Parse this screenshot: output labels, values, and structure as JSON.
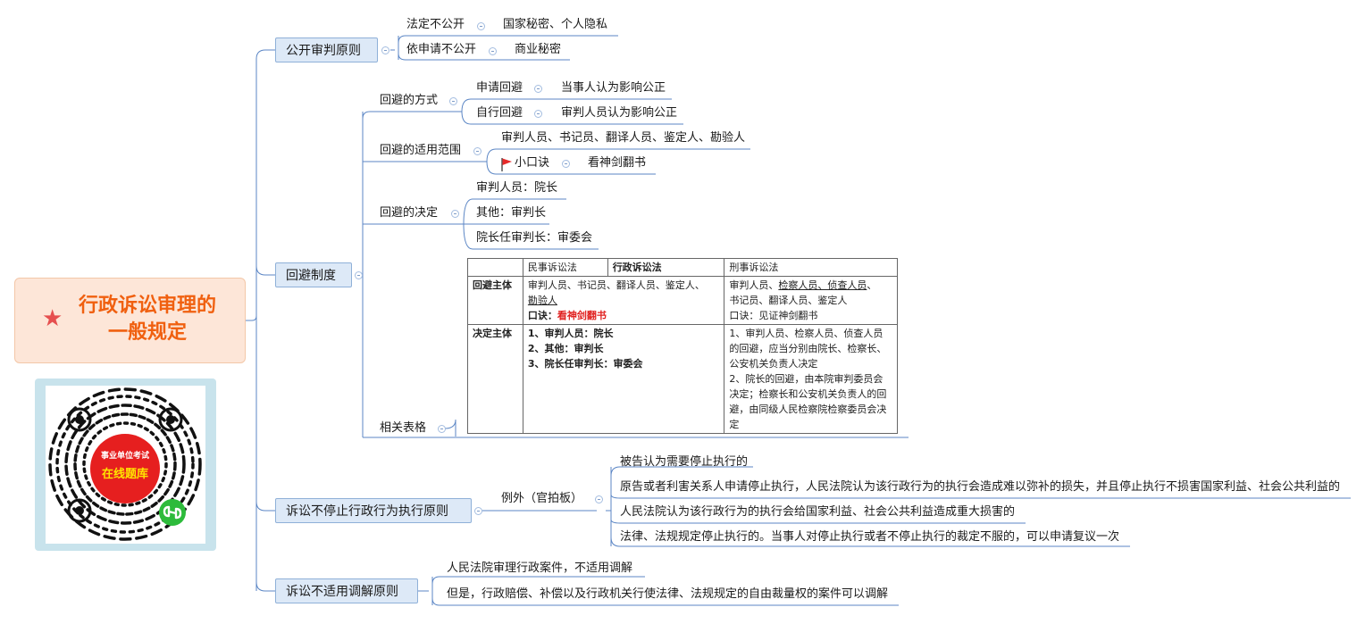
{
  "root": {
    "title_line1": "行政诉讼审理的",
    "title_line2": "一般规定"
  },
  "qr": {
    "line1": "事业单位考试",
    "line2": "在线题库"
  },
  "b1": {
    "open": "公开审判原则",
    "recusal": "回避制度",
    "no_stop": "诉讼不停止行政行为执行原则",
    "no_mediation": "诉讼不适用调解原则"
  },
  "open": {
    "c1": "法定不公开",
    "c1_leaf": "国家秘密、个人隐私",
    "c2": "依申请不公开",
    "c2_leaf": "商业秘密"
  },
  "recusal": {
    "way": "回避的方式",
    "way_apply": "申请回避",
    "way_apply_leaf": "当事人认为影响公正",
    "way_self": "自行回避",
    "way_self_leaf": "审判人员认为影响公正",
    "scope": "回避的适用范围",
    "scope_leaf1": "审判人员、书记员、翻译人员、鉴定人、勘验人",
    "scope_tip": "小口诀",
    "scope_tip_leaf": "看神剑翻书",
    "decision": "回避的决定",
    "dec1": "审判人员：院长",
    "dec2": "其他：审判长",
    "dec3": "院长任审判长：审委会",
    "table_label": "相关表格"
  },
  "table": {
    "h_civil": "民事诉讼法",
    "h_admin": "行政诉讼法",
    "h_criminal": "刑事诉讼法",
    "r1_label": "回避主体",
    "r1_civil_a": "审判人员、书记员、翻译人员、鉴定人、",
    "r1_civil_b": "勘验人",
    "r1_civil_tip_label": "口诀：",
    "r1_civil_tip": "看神剑翻书",
    "r1_crim_a": "审判人员、",
    "r1_crim_b": "检察人员、侦查人员",
    "r1_crim_c": "、",
    "r1_crim_d": "书记员、翻译人员、鉴定人",
    "r1_crim_tip": "口诀：见证神剑翻书",
    "r2_label": "决定主体",
    "r2_civil_1": "1、审判人员：院长",
    "r2_civil_2": "2、其他：审判长",
    "r2_civil_3": "3、院长任审判长：审委会",
    "r2_crim": "1、审判人员、检察人员、侦查人员的回避，应当分别由院长、检察长、公安机关负责人决定\n2、院长的回避，由本院审判委员会决定；检察长和公安机关负责人的回避，由同级人民检察院检察委员会决定"
  },
  "no_stop": {
    "exception": "例外（官拍板）",
    "e1": "被告认为需要停止执行的",
    "e2": "原告或者利害关系人申请停止执行，人民法院认为该行政行为的执行会造成难以弥补的损失，并且停止执行不损害国家利益、社会公共利益的",
    "e3": "人民法院认为该行政行为的执行会给国家利益、社会公共利益造成重大损害的",
    "e4": "法律、法规规定停止执行的。当事人对停止执行或者不停止执行的裁定不服的，可以申请复议一次"
  },
  "no_mediation": {
    "m1": "人民法院审理行政案件，不适用调解",
    "m2": "但是，行政赔偿、补偿以及行政机关行使法律、法规规定的自由裁量权的案件可以调解"
  },
  "colors": {
    "line": "#5b86c5",
    "branch_fill": "#dde9f7",
    "root_fill": "#fde6d8",
    "root_text": "#f06010"
  }
}
